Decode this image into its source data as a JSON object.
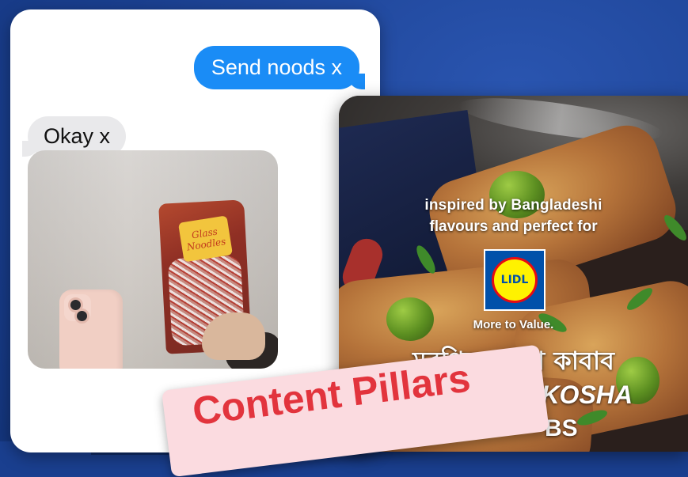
{
  "chat": {
    "outgoing_message": "Send noods x",
    "incoming_message": "Okay x",
    "photo_bag_label_line1": "Glass",
    "photo_bag_label_line2": "Noodles"
  },
  "ad": {
    "line1": "inspired by Bangladeshi",
    "line2": "flavours and perfect for",
    "brand": "LIDL",
    "tagline": "More to Value.",
    "dish_bengali": "মুরগির কোশা কাবাব",
    "dish_english_partial": "KOSHA",
    "dish_english_partial_2": "BS"
  },
  "badge": {
    "label": "Content Pillars"
  },
  "colors": {
    "background": "#1a3f8f",
    "imessage_blue": "#1a8cf6",
    "badge_bg": "#fbdbe0",
    "badge_text": "#e2343d",
    "lidl_blue": "#0050aa",
    "lidl_yellow": "#fff200"
  }
}
